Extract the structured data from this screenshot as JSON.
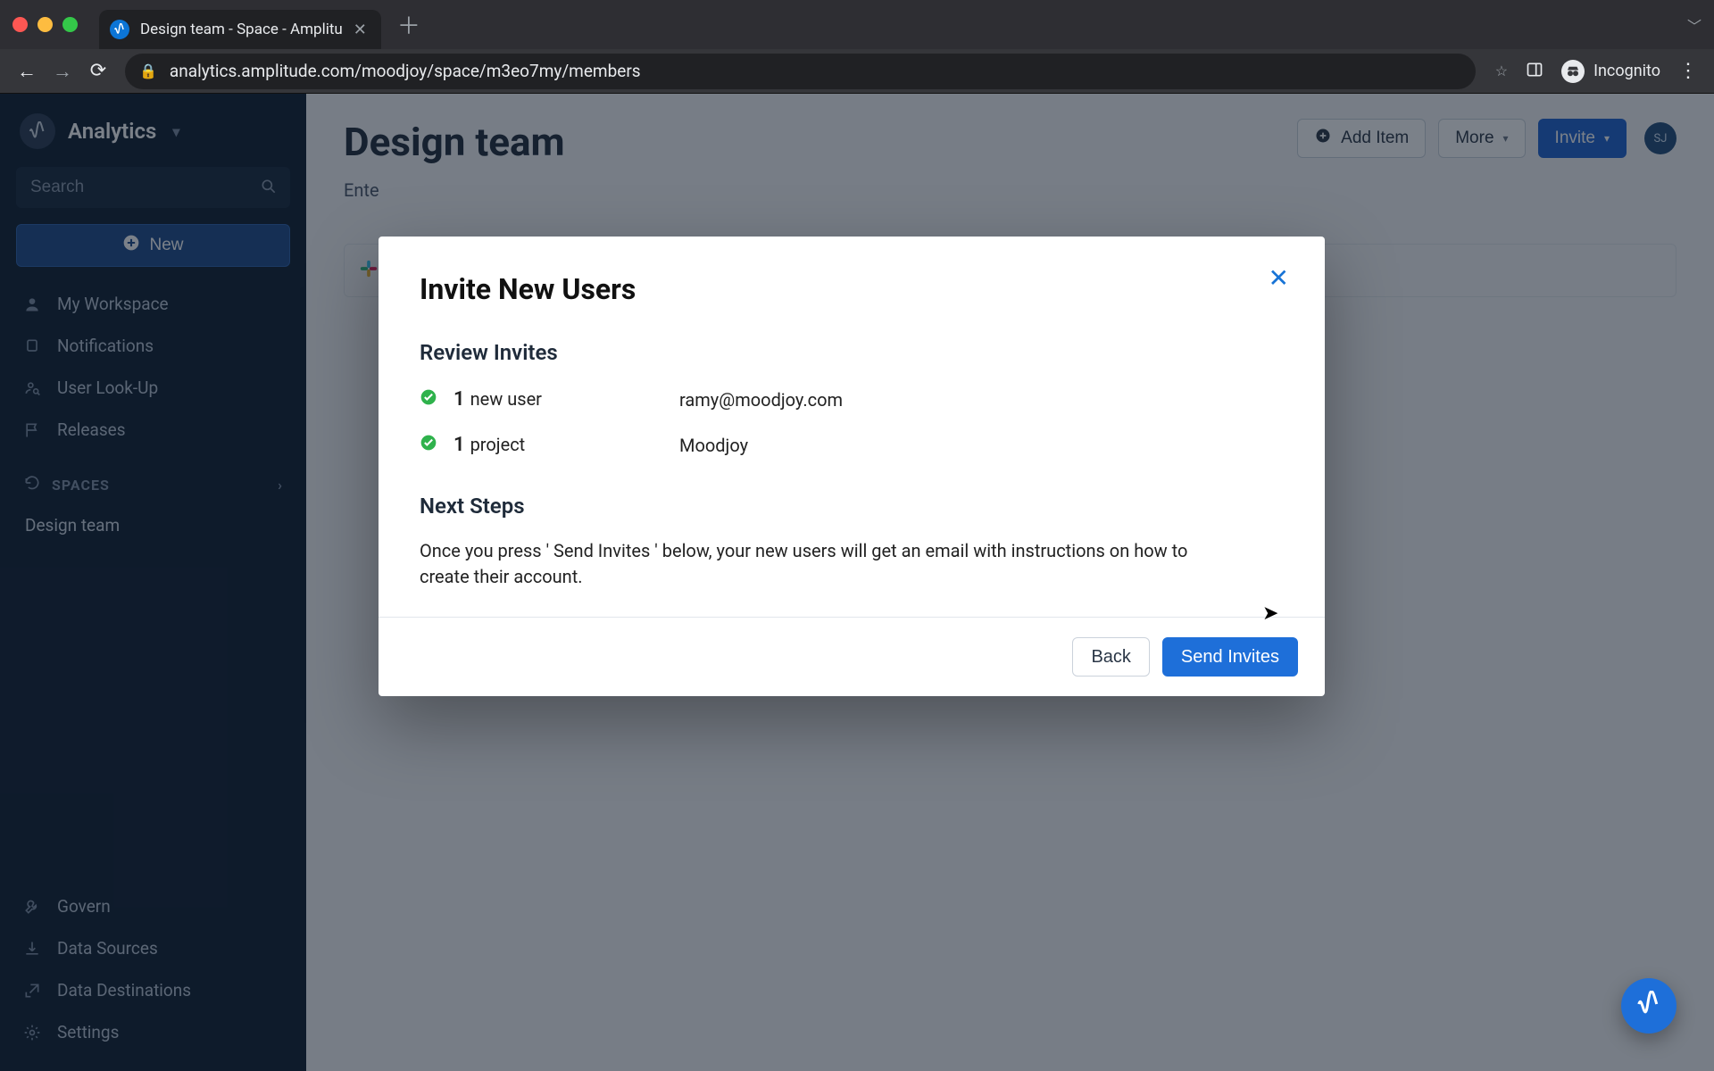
{
  "browser": {
    "tab_title": "Design team - Space - Amplitu",
    "url": "analytics.amplitude.com/moodjoy/space/m3eo7my/members",
    "incognito_label": "Incognito"
  },
  "sidebar": {
    "brand": "Analytics",
    "search_placeholder": "Search",
    "new_button": "New",
    "items": [
      {
        "label": "My Workspace"
      },
      {
        "label": "Notifications"
      },
      {
        "label": "User Look-Up"
      },
      {
        "label": "Releases"
      }
    ],
    "spaces_header": "SPACES",
    "spaces": [
      {
        "label": "Design team"
      }
    ],
    "bottom": [
      {
        "label": "Govern"
      },
      {
        "label": "Data Sources"
      },
      {
        "label": "Data Destinations"
      },
      {
        "label": "Settings"
      }
    ]
  },
  "page": {
    "title": "Design team",
    "subtitle_prefix": "Ente",
    "toolbar": {
      "add_item": "Add Item",
      "more": "More",
      "invite": "Invite"
    },
    "avatar_initials": "SJ"
  },
  "modal": {
    "title": "Invite New Users",
    "review_header": "Review Invites",
    "rows": [
      {
        "count": "1",
        "label": "new user",
        "value": "ramy@moodjoy.com"
      },
      {
        "count": "1",
        "label": "project",
        "value": "Moodjoy"
      }
    ],
    "next_header": "Next Steps",
    "next_text": "Once you press ' Send Invites ' below, your new users will get an email with instructions on how to create their account.",
    "back": "Back",
    "send": "Send Invites"
  }
}
